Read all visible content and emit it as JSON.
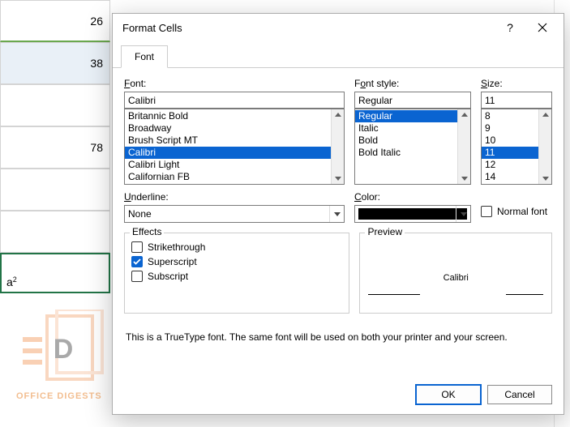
{
  "sheet": {
    "cells": [
      "26",
      "38",
      "",
      "78"
    ],
    "formula_cell": "a",
    "formula_sup": "2"
  },
  "dialog": {
    "title": "Format Cells",
    "tab": "Font",
    "font": {
      "label": "Font:",
      "value": "Calibri",
      "list": [
        "Britannic Bold",
        "Broadway",
        "Brush Script MT",
        "Calibri",
        "Calibri Light",
        "Californian FB"
      ],
      "selected": "Calibri"
    },
    "style": {
      "label": "Font style:",
      "value": "Regular",
      "list": [
        "Regular",
        "Italic",
        "Bold",
        "Bold Italic"
      ],
      "selected": "Regular"
    },
    "size": {
      "label": "Size:",
      "value": "11",
      "list": [
        "8",
        "9",
        "10",
        "11",
        "12",
        "14"
      ],
      "selected": "11"
    },
    "underline": {
      "label": "Underline:",
      "value": "None"
    },
    "color": {
      "label": "Color:",
      "value": "#000000"
    },
    "normal_font": "Normal font",
    "effects": {
      "label": "Effects",
      "strike": "Strikethrough",
      "super": "Superscript",
      "sub": "Subscript",
      "strike_checked": false,
      "super_checked": true,
      "sub_checked": false
    },
    "preview": {
      "label": "Preview",
      "text": "Calibri"
    },
    "description": "This is a TrueType font.  The same font will be used on both your printer and your screen.",
    "ok": "OK",
    "cancel": "Cancel"
  },
  "watermark": "OFFICE DIGESTS"
}
